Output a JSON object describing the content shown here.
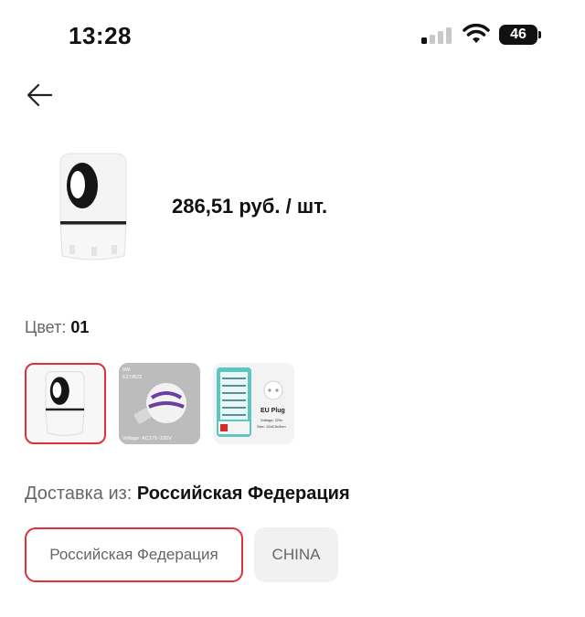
{
  "status_bar": {
    "time": "13:28",
    "battery_level": "46",
    "signal_bars_active": 1,
    "signal_bars_total": 4
  },
  "header": {
    "back_icon": "arrow-left-icon"
  },
  "product": {
    "price": "286,51 руб. / шт."
  },
  "color": {
    "label": "Цвет:",
    "selected_value": "01",
    "options": [
      {
        "id": "01",
        "icon": "mosquito-lamp-image",
        "selected": true
      },
      {
        "id": "bulb",
        "icon": "mosquito-bulb-image",
        "text_top": "9W\nE27/B22",
        "text_bottom": "Voltage: AC175~220V",
        "selected": false
      },
      {
        "id": "plug",
        "icon": "plug-zapper-image",
        "text_title": "EU Plug",
        "text_voltage": "Voltage: 220v",
        "text_size": "Size: 12x6.5x3cm",
        "selected": false
      }
    ]
  },
  "shipping": {
    "label": "Доставка из:",
    "selected_value": "Российская Федерация",
    "options": [
      {
        "label": "Российская Федерация",
        "selected": true
      },
      {
        "label": "CHINA",
        "selected": false
      }
    ]
  },
  "colors": {
    "accent": "#e0303a",
    "chip_bg": "#f1f1f1",
    "muted_text": "#666666"
  }
}
